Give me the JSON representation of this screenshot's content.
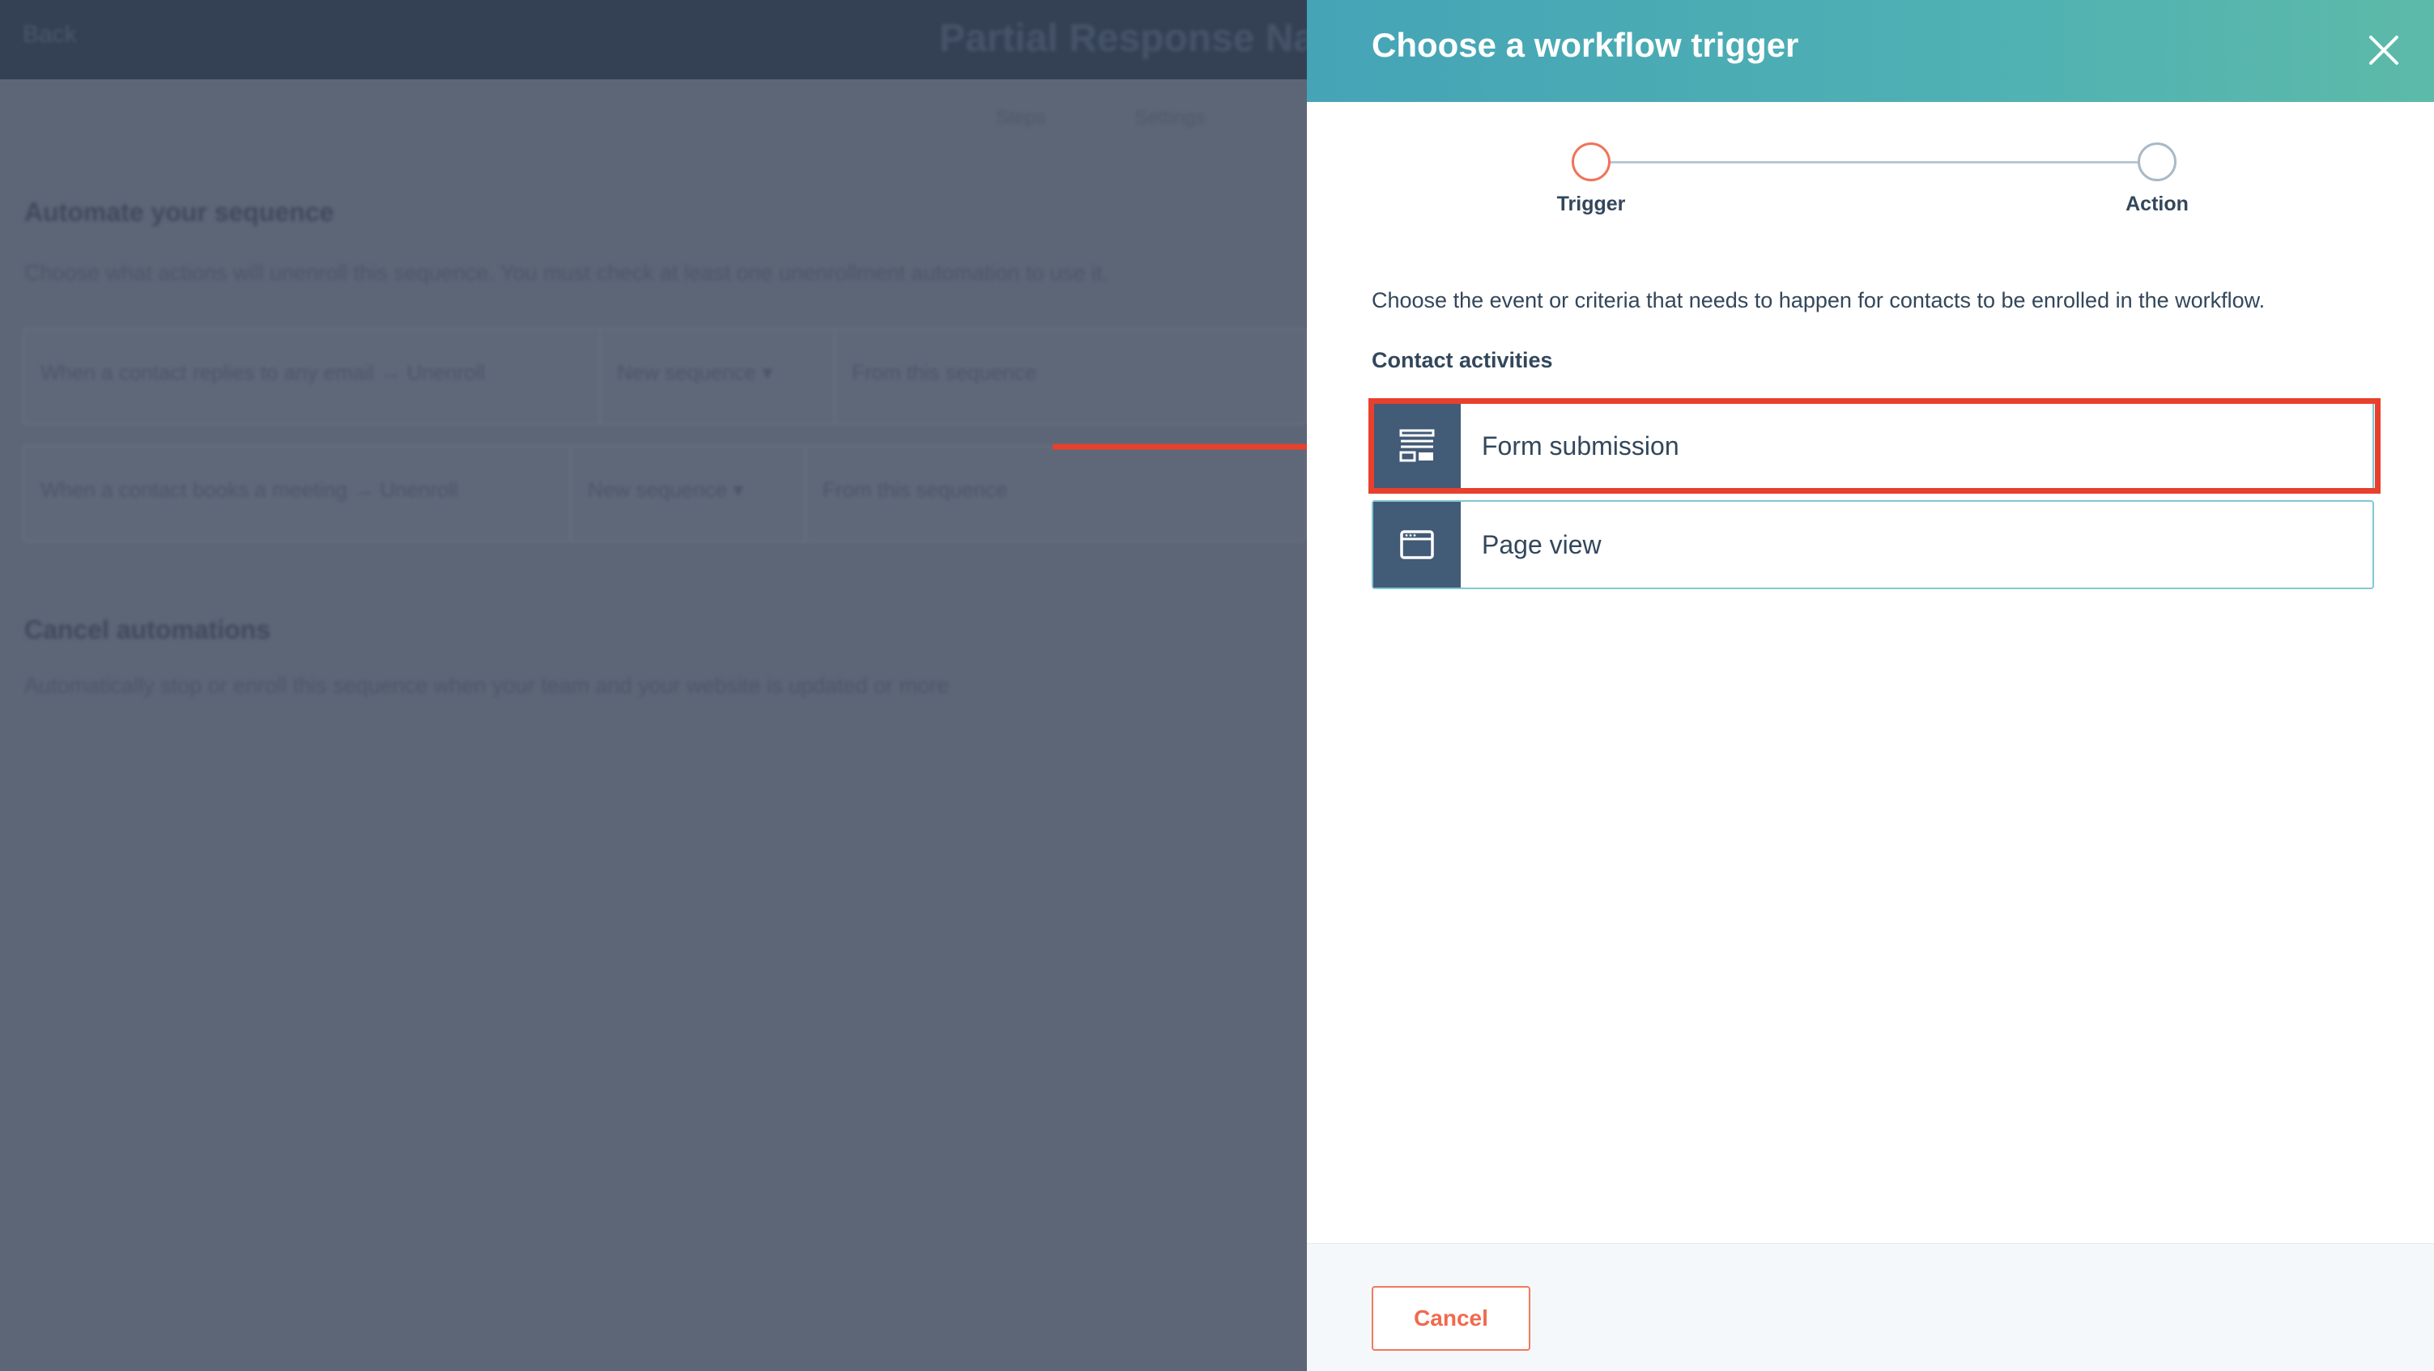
{
  "background": {
    "back_label": "Back",
    "page_title": "Partial Response Na",
    "tabs": [
      "Steps",
      "Settings"
    ],
    "automate_heading": "Automate your sequence",
    "automate_desc": "Choose what actions will unenroll this sequence. You must check at least one unenrollment automation to use it.",
    "rows": [
      {
        "trigger": "When a contact replies to any email → Unenroll",
        "select": "New sequence ▾",
        "action": "From this sequence"
      },
      {
        "trigger": "When a contact books a meeting → Unenroll",
        "select": "New sequence ▾",
        "action": "From this sequence"
      }
    ],
    "cancel_heading": "Cancel automations",
    "cancel_desc": "Automatically stop or enroll this sequence when your team and your website is updated or more"
  },
  "panel": {
    "title": "Choose a workflow trigger",
    "close_icon": "close-icon",
    "steps": [
      {
        "label": "Trigger",
        "state": "active"
      },
      {
        "label": "Action",
        "state": "pending"
      }
    ],
    "instructions": "Choose the event or criteria that needs to happen for contacts to be enrolled in the workflow.",
    "section_heading": "Contact activities",
    "options": [
      {
        "label": "Form submission",
        "icon": "form-icon",
        "highlighted": true
      },
      {
        "label": "Page view",
        "icon": "browser-window-icon",
        "highlighted": false
      }
    ],
    "cancel_label": "Cancel"
  },
  "colors": {
    "accent": "#f0735a",
    "header_start": "#45a4b6",
    "header_end": "#5dbaa9",
    "highlight": "#e8402c",
    "icon_bg": "#425b76",
    "text": "#33475b"
  }
}
